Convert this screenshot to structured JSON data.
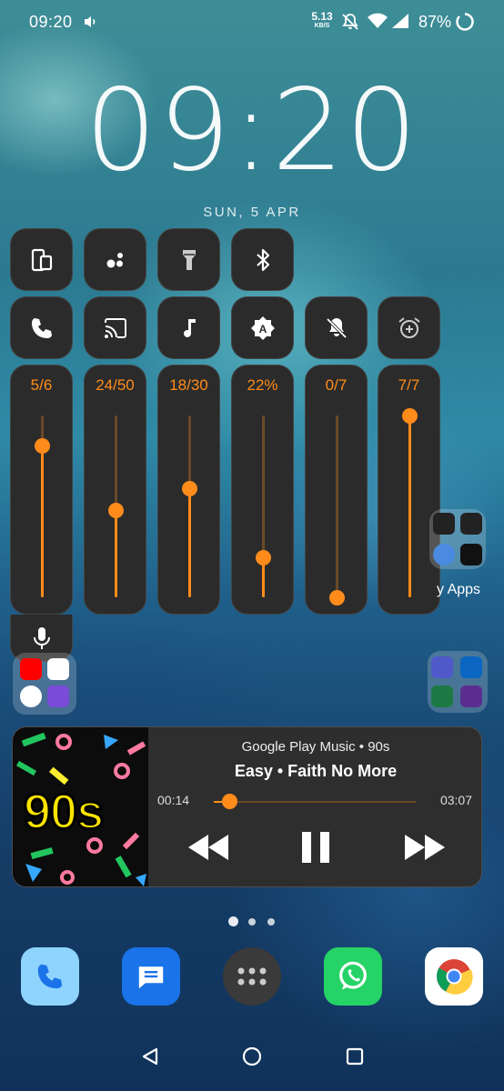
{
  "status_bar": {
    "time": "09:20",
    "net_speed_value": "5.13",
    "net_speed_unit": "KB/S",
    "battery_percent": "87%"
  },
  "lock": {
    "clock": "09:20",
    "date": "SUN, 5 APR"
  },
  "quick_tiles_row1": [
    "screen-rotate-icon",
    "assistant-icon",
    "flashlight-icon",
    "bluetooth-icon"
  ],
  "quick_tiles_row2": [
    "call-volume-icon",
    "cast-icon",
    "media-volume-icon",
    "auto-brightness-icon",
    "notification-muted-icon",
    "alarm-add-icon"
  ],
  "sliders": [
    {
      "label": "5/6",
      "level": 0.833,
      "kind": "ring"
    },
    {
      "label": "24/50",
      "level": 0.48,
      "kind": "media"
    },
    {
      "label": "18/30",
      "level": 0.6,
      "kind": "music"
    },
    {
      "label": "22%",
      "level": 0.22,
      "kind": "brightness"
    },
    {
      "label": "0/7",
      "level": 0.0,
      "kind": "notification"
    },
    {
      "label": "7/7",
      "level": 1.0,
      "kind": "alarm"
    }
  ],
  "home": {
    "folder_label_partial": "y Apps"
  },
  "media": {
    "source": "Google Play Music  •  90s",
    "title": "Easy  •  Faith No More",
    "elapsed": "00:14",
    "total": "03:07",
    "progress": 0.075,
    "art_text": "90s"
  },
  "colors": {
    "accent": "#ff8c1a",
    "tile_bg": "#2b2b2b"
  },
  "dock": [
    "phone-app-icon",
    "messages-app-icon",
    "app-drawer-icon",
    "whatsapp-app-icon",
    "chrome-app-icon"
  ]
}
